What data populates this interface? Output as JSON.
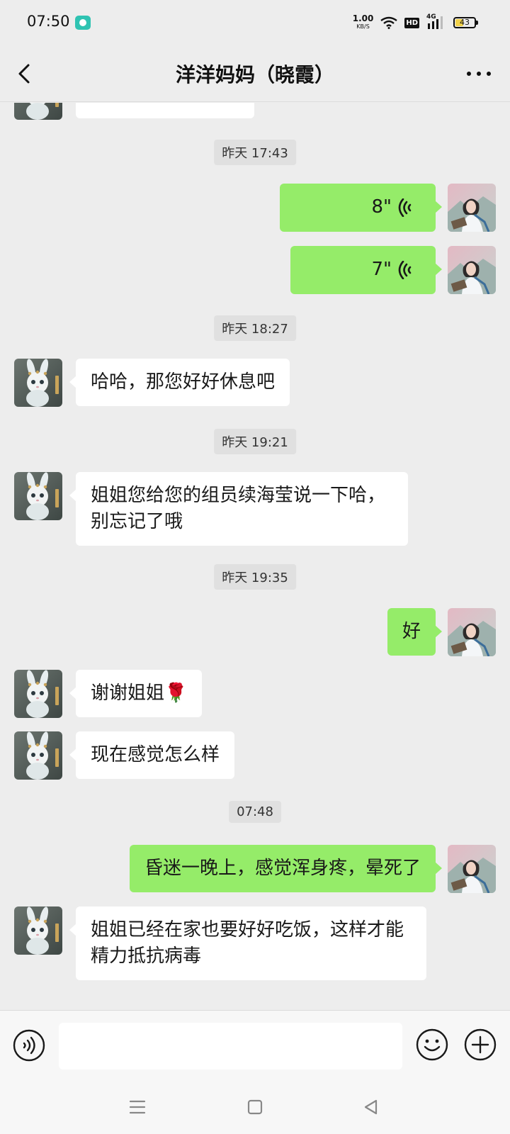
{
  "status_bar": {
    "time": "07:50",
    "net_speed_value": "1.00",
    "net_speed_unit": "KB/S",
    "hd_label": "HD",
    "network_label": "4G",
    "battery_level": "43",
    "battery_fraction": 0.43
  },
  "header": {
    "title": "洋洋妈妈（晓霞）"
  },
  "messages": [
    {
      "kind": "time",
      "text": "昨天 17:43"
    },
    {
      "kind": "voice",
      "from": "me",
      "duration": "8\""
    },
    {
      "kind": "voice",
      "from": "me",
      "duration": "7\""
    },
    {
      "kind": "time",
      "text": "昨天 18:27"
    },
    {
      "kind": "text",
      "from": "other",
      "text": "哈哈，那您好好休息吧"
    },
    {
      "kind": "time",
      "text": "昨天 19:21"
    },
    {
      "kind": "text",
      "from": "other",
      "text": "姐姐您给您的组员续海莹说一下哈，别忘记了哦"
    },
    {
      "kind": "time",
      "text": "昨天 19:35"
    },
    {
      "kind": "text",
      "from": "me",
      "text": "好"
    },
    {
      "kind": "text",
      "from": "other",
      "text": "谢谢姐姐🌹"
    },
    {
      "kind": "text",
      "from": "other",
      "text": "现在感觉怎么样"
    },
    {
      "kind": "time",
      "text": "07:48"
    },
    {
      "kind": "text",
      "from": "me",
      "text": "昏迷一晚上，感觉浑身疼，晕死了"
    },
    {
      "kind": "text",
      "from": "other",
      "text": "姐姐已经在家也要好好吃饭，这样才能精力抵抗病毒"
    }
  ],
  "input_bar": {
    "value": "",
    "placeholder": ""
  },
  "colors": {
    "background": "#ededed",
    "bubble_out": "#95ec69",
    "bubble_in": "#ffffff"
  },
  "icons": {
    "back": "chevron-left-icon",
    "more": "more-dots-icon",
    "voice_input": "voice-input-icon",
    "emoji": "emoji-icon",
    "plus": "plus-icon"
  }
}
